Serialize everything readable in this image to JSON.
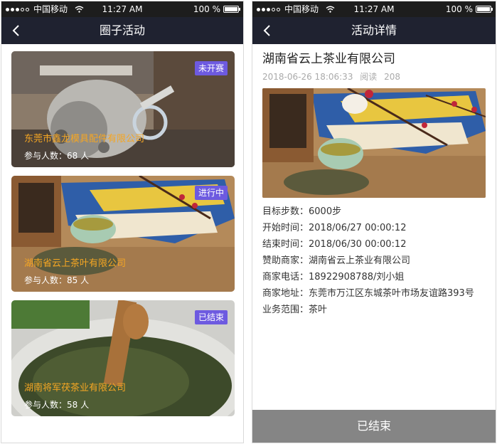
{
  "status": {
    "carrier": "中国移动",
    "time": "11:27 AM",
    "battery": "100 %"
  },
  "left": {
    "title": "圈子活动",
    "cards": [
      {
        "name": "东莞市鑫龙模具配件有限公司",
        "participants": "参与人数：68 人",
        "badge": "未开赛"
      },
      {
        "name": "湖南省云上茶叶有限公司",
        "participants": "参与人数：85 人",
        "badge": "进行中"
      },
      {
        "name": "湖南将军茯茶业有限公司",
        "participants": "参与人数：58 人",
        "badge": "已结束"
      }
    ]
  },
  "right": {
    "title": "活动详情",
    "company": "湖南省云上茶业有限公司",
    "datetime": "2018-06-26 18:06:33",
    "read_label": "阅读",
    "read_count": "208",
    "rows": [
      {
        "k": "目标步数：",
        "v": "6000步"
      },
      {
        "k": "开始时间：",
        "v": "2018/06/27  00:00:12"
      },
      {
        "k": "结束时间：",
        "v": "2018/06/30  00:00:12"
      },
      {
        "k": "赞助商家：",
        "v": "湖南省云上茶业有限公司"
      },
      {
        "k": "商家电话：",
        "v": "18922908788/刘小姐"
      },
      {
        "k": "商家地址：",
        "v": "东莞市万江区东城茶叶市场友谊路393号"
      },
      {
        "k": "业务范围：",
        "v": "茶叶"
      }
    ],
    "footer": "已结束"
  }
}
